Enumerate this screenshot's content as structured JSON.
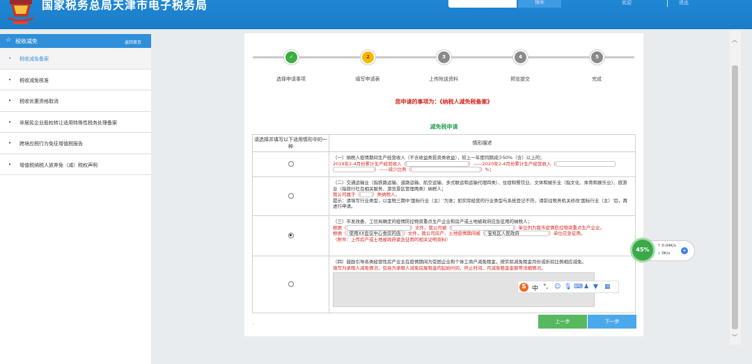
{
  "header": {
    "site_title": "国家税务总局天津市电子税务局",
    "search_button": "搜索",
    "user": "欢迎",
    "logout": "退出"
  },
  "sidebar": {
    "title": "税收减免",
    "back": "返回首页",
    "items": [
      {
        "label": "税收减免备案",
        "active": true
      },
      {
        "label": "税收减免核准"
      },
      {
        "label": "税收优惠资格取消"
      },
      {
        "label": "非居民企业股权转让适用特殊性税务处理备案"
      },
      {
        "label": "跨境应税行为免征增值税报告"
      },
      {
        "label": "增值税纳税人放弃免（减）税权声明"
      }
    ]
  },
  "steps": [
    {
      "num": "✓",
      "label": "选择申请事项",
      "state": "done"
    },
    {
      "num": "2",
      "label": "填写申请表",
      "state": "current"
    },
    {
      "num": "3",
      "label": "上传附送资料",
      "state": "todo"
    },
    {
      "num": "4",
      "label": "预览提交",
      "state": "todo"
    },
    {
      "num": "5",
      "label": "完成",
      "state": "todo"
    }
  ],
  "request_line": "您申请的事项为：《纳税人减免税备案》",
  "form_title": "减免税申请",
  "table": {
    "col1_header": "请选择并填写以下适用情形中的一种",
    "col2_header": "情形描述",
    "rows": [
      {
        "selected": false,
        "l1": "（一）纳税人疫情期间生产经营收入（不含收益类投资类收益），较上一年度同期减少50%（含）以上的；",
        "l2a": "2019年2-4月份累计生产经营收入（",
        "l2b": "）——2020年2-4月份累计生产经营收入（",
        "l3a": "）——减少比例（",
        "l3b": "）%；"
      },
      {
        "selected": false,
        "l1": "（二）交通运输业（指铁路运输、道路运输、航空运输、多式联运和运输代理四类）、住宿和餐饮业、文体和娱乐业（指文化、体育和娱乐业）、旅游业（指旅行社及相关服务、游览景区管理两类）纳税人；",
        "l2a": "我公司属于（",
        "l2b": "）类纳税人。",
        "l3": "提示：请填写行业类型，以金税三期中'国标行业（主）'为准；如实际经营的行业类型与系统登记不符，请前往税务机关修改'国标行业（主）'后，再进行申请。"
      },
      {
        "selected": true,
        "l1": "（三）市发改委、工信局确定的疫情防控物资重点生产企业和房产或土地被政府应急征用的纳税人；",
        "l2a": "根据（",
        "l2b": "）文件，我公司被（",
        "l2c": "）单位列为我市疫情防控物资重点生产企业。",
        "l3a": "根据（",
        "l3_val1": "使用XX会议中心食房的函",
        "l3b": "）文件，我公司房产、土地疫情期间被（",
        "l3_val2": "宝坻区人民政府",
        "l3c": "）单位应急征用。",
        "l4": "（附件：上传房产或土地被政府紧急征用的相关证明资料）"
      },
      {
        "selected": false,
        "l1": "（四）鼓励引导各类经营性房产业主在疫情期间为受困企业和个体工商户减免租金，按实际减免租金月份或折扣比例相应减免。",
        "l2": "填写为承租人减免情况，包括为承租人减免房屋租金的起始时间，终止时间，月减免租金金额等详细情况。"
      }
    ]
  },
  "bottom_dot": ".",
  "buttons": {
    "prev": "上一步",
    "next": "下一步"
  },
  "net_widget": {
    "percent": "45%",
    "up": "0.04K/s",
    "down": "0K/s"
  },
  "ime": {
    "logo": "S",
    "mode": "中"
  },
  "colors": {
    "header_blue": "#1f87d4",
    "step_done": "#3aae3f",
    "step_current": "#f7b700",
    "step_todo": "#8a8a8a",
    "alert_red": "#d6261f",
    "form_title_green": "#2aa251",
    "btn_prev": "#58b85f",
    "btn_next": "#4ba8ea"
  }
}
